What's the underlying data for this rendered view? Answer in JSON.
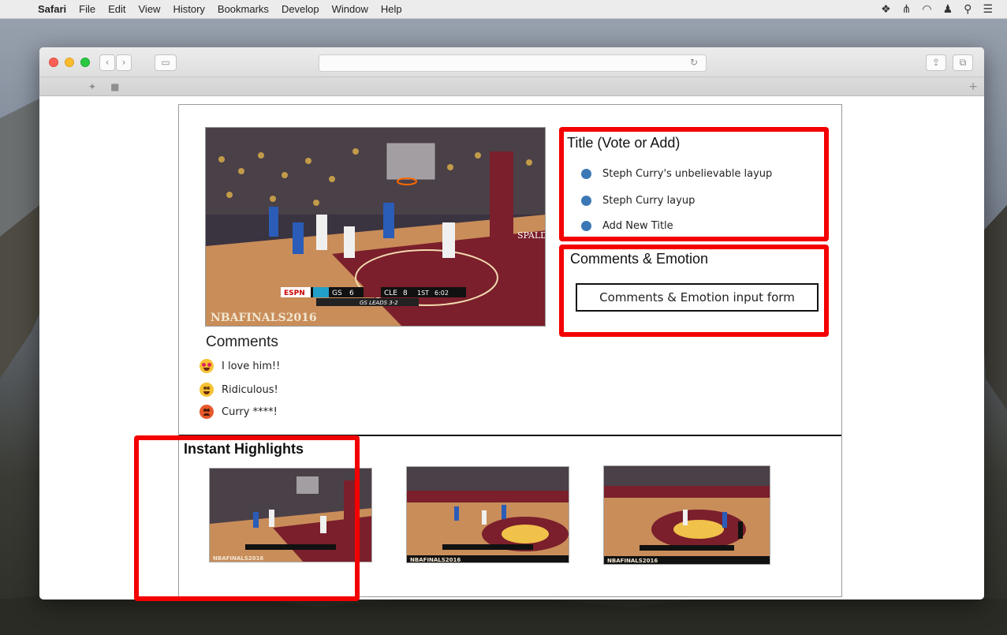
{
  "menubar": {
    "app": "Safari",
    "items": [
      "File",
      "Edit",
      "View",
      "History",
      "Bookmarks",
      "Develop",
      "Window",
      "Help"
    ]
  },
  "video": {
    "team_left": "GS",
    "score_left": "6",
    "team_right": "CLE",
    "score_right": "8",
    "quarter": "1ST",
    "clock": "6:02",
    "series": "GS LEADS 3-2",
    "watermark": "NBAFINALS2016",
    "network": "ESPN",
    "court_brand": "SPALDING"
  },
  "comments": {
    "title": "Comments",
    "items": [
      {
        "emoji": "heart-eyes",
        "text": "I love him!!"
      },
      {
        "emoji": "grin",
        "text": "Ridiculous!"
      },
      {
        "emoji": "angry",
        "text": "Curry ****!"
      }
    ]
  },
  "title_box": {
    "heading": "Title (Vote or Add)",
    "items": [
      "Steph Curry's unbelievable layup",
      "Steph Curry layup",
      "Add New Title"
    ]
  },
  "emotion_box": {
    "heading": "Comments & Emotion",
    "input_label": "Comments & Emotion input form"
  },
  "highlights": {
    "heading": "Instant Highlights",
    "thumbs": [
      {
        "watermark": "NBAFINALS2016"
      },
      {
        "watermark": "NBAFINALS2016"
      },
      {
        "watermark": "NBAFINALS2016"
      }
    ]
  },
  "colors": {
    "annotation": "#f30000",
    "bullet": "#3c78b5",
    "court_wood": "#c98d5a",
    "court_paint": "#7a1f2b"
  }
}
